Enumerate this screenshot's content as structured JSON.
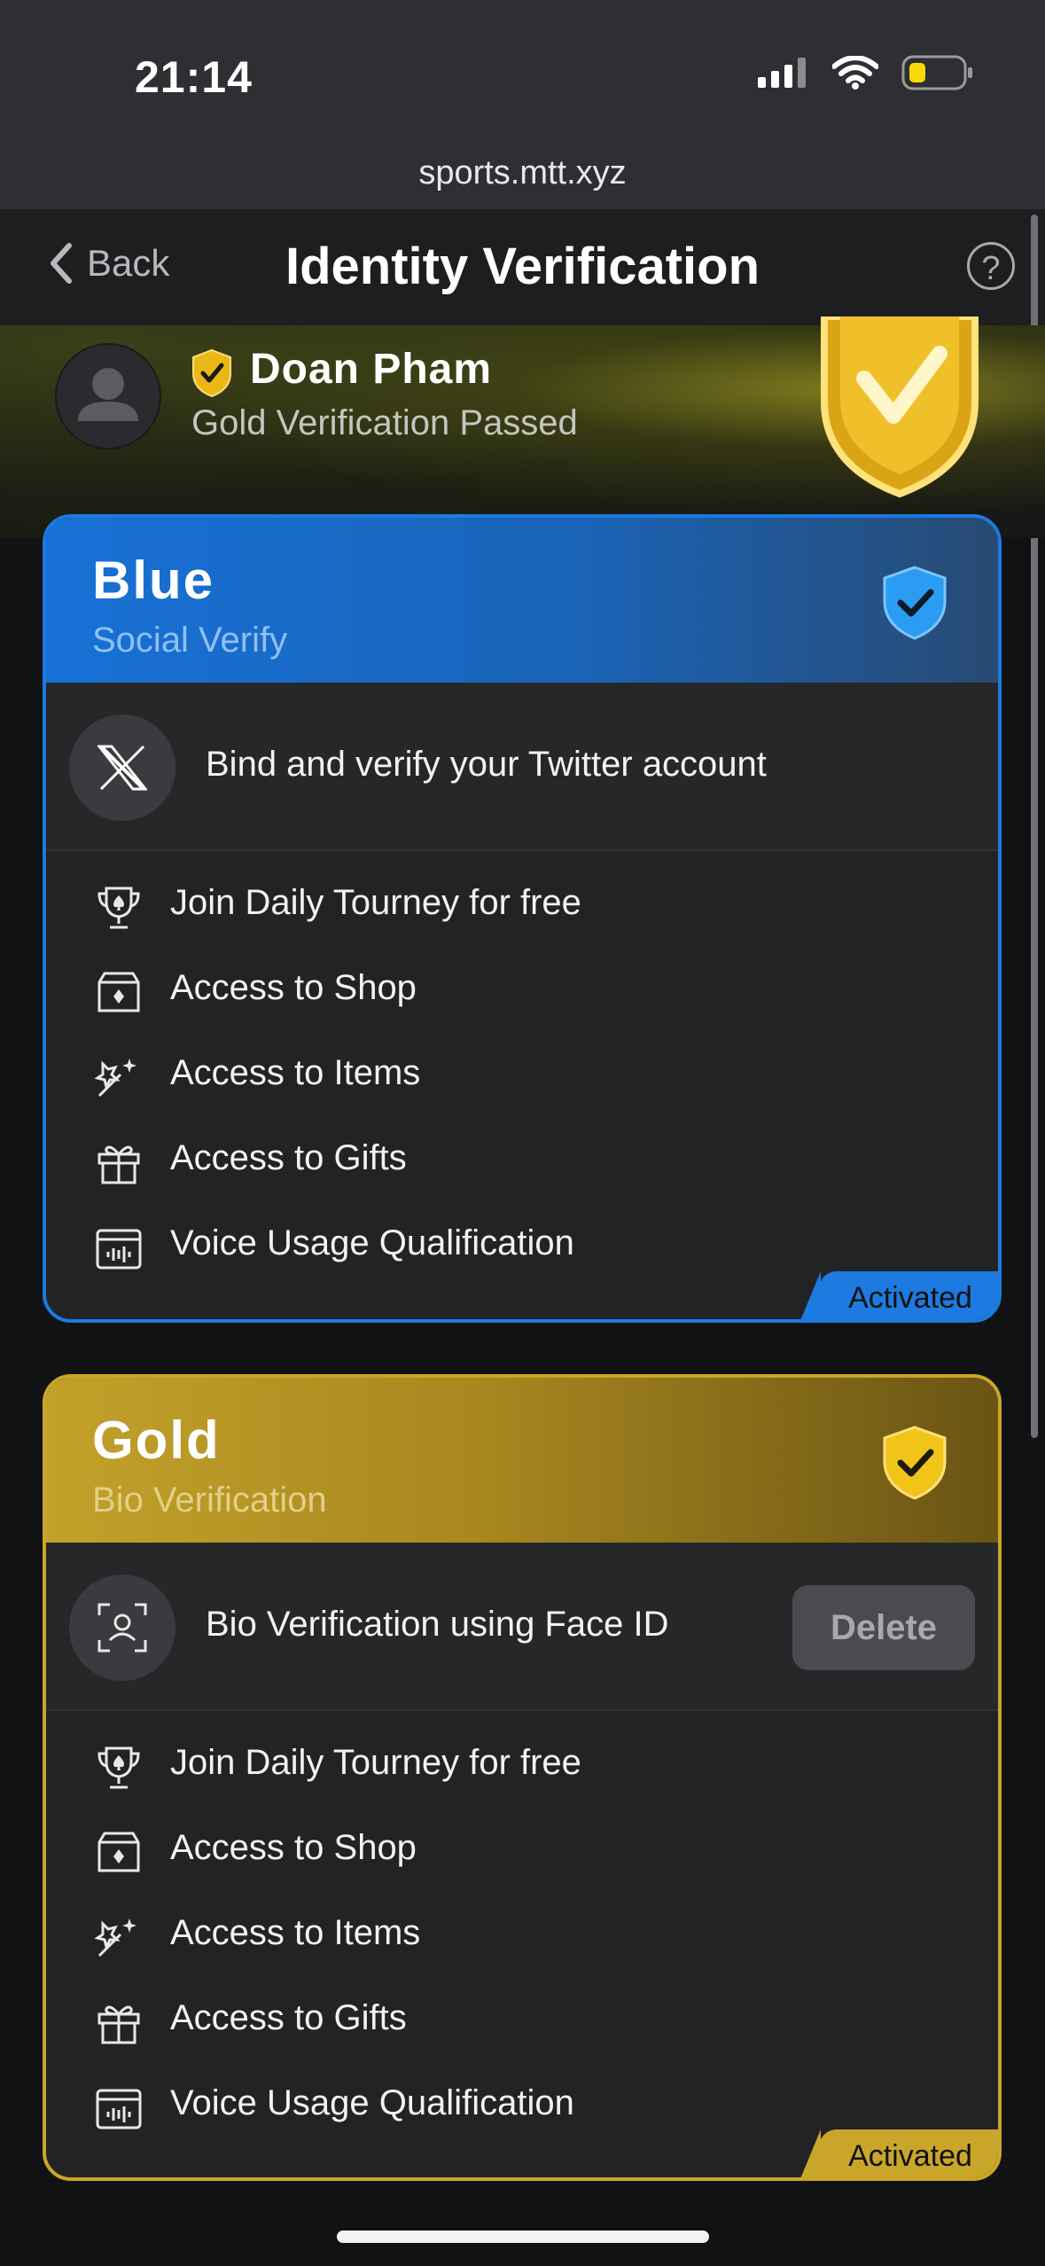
{
  "status_bar": {
    "time": "21:14"
  },
  "browser": {
    "url": "sports.mtt.xyz"
  },
  "nav": {
    "back_label": "Back",
    "title": "Identity Verification",
    "help_label": "?"
  },
  "user": {
    "name": "Doan Pham",
    "status": "Gold Verification Passed"
  },
  "cards": [
    {
      "title": "Blue",
      "subtitle": "Social Verify",
      "method": "Bind and verify your Twitter account",
      "features": [
        "Join Daily Tourney for free",
        "Access to Shop",
        "Access to Items",
        "Access to Gifts",
        "Voice Usage Qualification"
      ],
      "badge": "Activated",
      "accent": "#1c7ae0"
    },
    {
      "title": "Gold",
      "subtitle": "Bio Verification",
      "method": "Bio Verification using Face ID",
      "action_label": "Delete",
      "features": [
        "Join Daily Tourney for free",
        "Access to Shop",
        "Access to Items",
        "Access to Gifts",
        "Voice Usage Qualification"
      ],
      "badge": "Activated",
      "accent": "#c9a629"
    }
  ],
  "icons": {
    "status": [
      "cellular-signal-icon",
      "wifi-icon",
      "battery-low-icon"
    ],
    "features": [
      "trophy-spade-icon",
      "shop-icon",
      "magic-wand-icon",
      "gift-icon",
      "voice-card-icon"
    ]
  }
}
